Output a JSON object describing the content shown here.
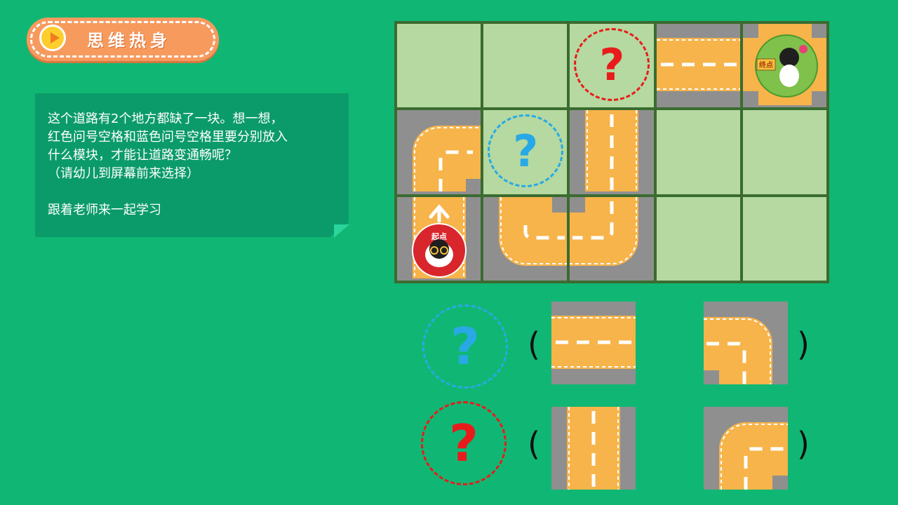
{
  "header": {
    "title": "思维热身"
  },
  "note": {
    "lines": [
      "这个道路有2个地方都缺了一块。想一想，",
      "红色问号空格和蓝色问号空格里要分别放入",
      "什么模块，才能让道路变通畅呢？",
      "（请幼儿到屏幕前来选择）"
    ],
    "footer": "跟着老师来一起学习"
  },
  "board": {
    "question_mark": "?",
    "start_label": "起点",
    "end_label": "终点"
  },
  "answers": {
    "question_mark": "?",
    "open_paren": "(",
    "close_paren": ")"
  },
  "colors": {
    "background": "#10b774",
    "grass": "#b5d9a0",
    "road": "#f7b44a",
    "asphalt": "#8f8f8f",
    "red": "#e81b1b",
    "blue": "#28a9e6"
  }
}
